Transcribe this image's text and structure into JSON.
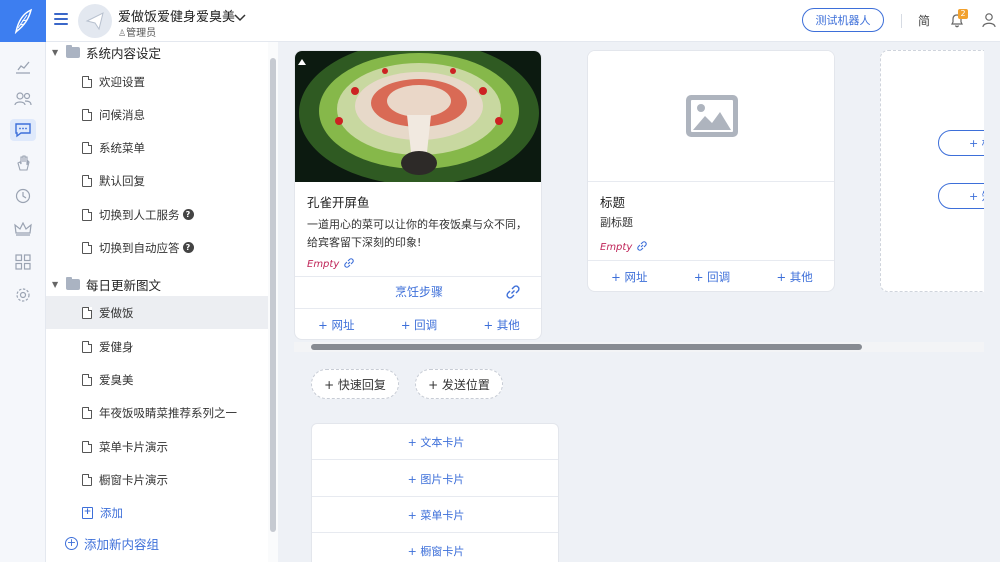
{
  "header": {
    "app_title": "爱做饭爱健身爱臭美",
    "role": "管理员",
    "test_robot_button": "测试机器人",
    "language": "简",
    "notification_count": "2"
  },
  "tree": {
    "groups": [
      {
        "label": "系统内容设定",
        "items": [
          "欢迎设置",
          "问候消息",
          "系统菜单",
          "默认回复",
          "切换到人工服务",
          "切换到自动应答"
        ]
      },
      {
        "label": "每日更新图文",
        "items": [
          "爱做饭",
          "爱健身",
          "爱臭美",
          "年夜饭吸睛菜推荐系列之一",
          "菜单卡片演示",
          "橱窗卡片演示"
        ],
        "add_label": "添加"
      }
    ],
    "add_group_label": "添加新内容组"
  },
  "cards": [
    {
      "title": "孔雀开屏鱼",
      "description_line1": "一道用心的菜可以让你的年夜饭桌与众不同，",
      "description_line2": "给宾客留下深刻的印象!",
      "empty_label": "Empty",
      "button_label": "烹饪步骤",
      "actions": [
        "+ 网址",
        "+ 回调",
        "+ 其他"
      ]
    },
    {
      "title": "标题",
      "subtitle": "副标题",
      "empty_label": "Empty",
      "actions": [
        "+ 网址",
        "+ 回调",
        "+ 其他"
      ]
    }
  ],
  "side_pills": [
    "+ 标",
    "+ 知"
  ],
  "quick_pills": [
    "+ 快速回复",
    "+ 发送位置"
  ],
  "add_card_menu": [
    "+ 文本卡片",
    "+ 图片卡片",
    "+ 菜单卡片",
    "+ 橱窗卡片"
  ],
  "colors": {
    "accent": "#3d6fd9",
    "logo_bg": "#3d7ef0",
    "empty_text": "#c0275a",
    "badge": "#f2a12d"
  }
}
